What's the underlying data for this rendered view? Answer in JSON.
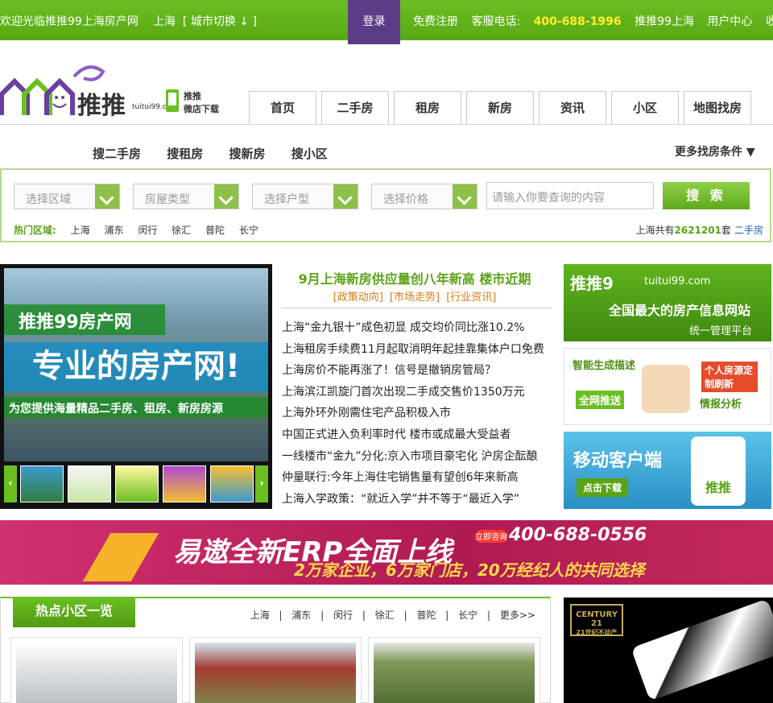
{
  "topbar": {
    "welcome": "欢迎光临推推99上海房产网",
    "city": "上海",
    "city_switch": "[ 城市切换 ↓ ]",
    "login": "登录",
    "register": "免费注册",
    "phone_label": "客服电话:",
    "phone": "400-688-1996",
    "site": "推推99上海",
    "user_center": "用户中心",
    "bookmark": "收藏本页"
  },
  "logo": {
    "brand": "推推",
    "domain": "tuitui99.com",
    "shop_line1": "推推",
    "shop_line2": "微店下载"
  },
  "nav": [
    "首页",
    "二手房",
    "租房",
    "新房",
    "资讯",
    "小区",
    "地图找房"
  ],
  "search": {
    "tabs": [
      "搜二手房",
      "搜租房",
      "搜新房",
      "搜小区"
    ],
    "more": "更多找房条件",
    "dropdowns": [
      "选择区域",
      "房屋类型",
      "选择户型",
      "选择价格"
    ],
    "keyword_placeholder": "请输入你要查询的内容",
    "button": "搜 索",
    "hot_label": "热门区域:",
    "hot_areas": [
      "上海",
      "浦东",
      "闵行",
      "徐汇",
      "普陀",
      "长宁"
    ],
    "total_prefix": "上海共有",
    "total_count": "2621201",
    "total_suffix": "套",
    "total_link": "二手房"
  },
  "slider": {
    "line1": "推推99房产网",
    "line2": "专业的房产网!",
    "line3": "为您提供海量精品二手房、租房、新房房源"
  },
  "news": {
    "headline": "9月上海新房供应量创八年新高 楼市近期",
    "categories": [
      "[政策动向]",
      "[市场走势]",
      "[行业资讯]"
    ],
    "items": [
      "上海“金九银十”成色初显 成交均价同比涨10.2%",
      "上海租房手续费11月起取消明年起挂靠集体户口免费",
      "上海房价不能再涨了！信号是撤销房管局？",
      "上海滨江凯旋门首次出现二手成交售价1350万元",
      "上海外环外刚需住宅产品积极入市",
      "中国正式进入负利率时代 楼市或成最大受益者",
      "一线楼市“金九”分化:京入市项目豪宅化 沪房企酝酿",
      "仲量联行:今年上海住宅销售量有望创6年来新高",
      "上海入学政策：“就近入学”并不等于“最近入学”"
    ]
  },
  "ads": {
    "ad1_brand": "推推9",
    "ad1_domain": "tuitui99.com",
    "ad1_title": "全国最大的房产信息网站",
    "ad1_sub": "统一管理平台",
    "ad2_a": "智能生成描述",
    "ad2_b": "全网推送",
    "ad2_c": "个人房源定制刷新",
    "ad2_d": "情报分析",
    "ad3_title": "移动客户端",
    "ad3_btn": "点击下载",
    "ad3_app": "推推"
  },
  "wide_banner": {
    "title": "易遨全新ERP全面上线",
    "sub": "2万家企业，6万家门店，20万经纪人的共同选择",
    "badge": "立即咨询",
    "phone": "400-688-0556"
  },
  "hot_community": {
    "title": "热点小区一览",
    "areas": [
      "上海",
      "|",
      "浦东",
      "|",
      "闵行",
      "|",
      "徐汇",
      "|",
      "普陀",
      "|",
      "长宁",
      "|",
      "更多>>"
    ]
  },
  "century": {
    "brand": "CENTURY 21",
    "sub": "21世纪不动产"
  }
}
